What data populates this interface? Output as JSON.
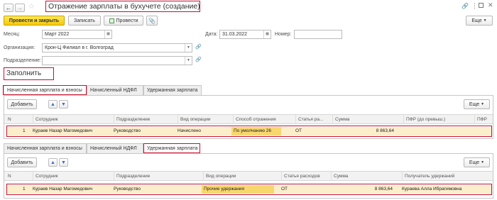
{
  "window": {
    "back_icon": "arrow-left-icon",
    "forward_icon": "arrow-right-icon",
    "favorite_icon": "star-icon",
    "title": "Отражение зарплаты в бухучете (создание)",
    "link_icon": "link-icon",
    "menu_icon": "more-dots-icon",
    "maximize_icon": "maximize-icon",
    "close_icon": "close-icon"
  },
  "toolbar": {
    "post_and_close": "Провести и закрыть",
    "save": "Записать",
    "post": "Провести",
    "attach_icon": "paperclip-icon",
    "more": "Еще"
  },
  "form": {
    "month_label": "Месяц:",
    "month_value": "Март 2022",
    "date_label": "Дата:",
    "date_value": "31.03.2022",
    "number_label": "Номер:",
    "number_value": "",
    "org_label": "Организация:",
    "org_value": "Крон-Ц Филиал в г. Волгоград",
    "dept_label": "Подразделение:",
    "dept_value": ""
  },
  "fill_button": "Заполнить",
  "tabs": [
    "Начисленная зарплата и взносы",
    "Начисленный НДФЛ",
    "Удержанная зарплата"
  ],
  "table1": {
    "add_button": "Добавить",
    "more": "Еще",
    "headers": [
      "N",
      "Сотрудник",
      "Подразделение",
      "Вид операции",
      "Способ отражения",
      "Статья ра...",
      "Сумма",
      "ПФР (до превыш.)",
      "ПФР"
    ],
    "rows": [
      {
        "n": "1",
        "employee": "Кураев Назар Магомедович",
        "department": "Руководство",
        "operation": "Начислено",
        "method": "По умолчанию 26",
        "article": "ОТ",
        "amount": "8 863,64",
        "pfr": "",
        "pfr2": ""
      }
    ]
  },
  "table2": {
    "add_button": "Добавить",
    "more": "Еще",
    "headers": [
      "N",
      "Сотрудник",
      "Подразделение",
      "Вид операции",
      "Статья расходов",
      "Сумма",
      "Получатель удержаний"
    ],
    "rows": [
      {
        "n": "1",
        "employee": "Кураев Назар Магомедович",
        "department": "Руководство",
        "operation": "Прочие удержания",
        "article": "ОТ",
        "amount": "8 863,64",
        "recipient": "Кураева Алла Ибрагимовна"
      }
    ]
  }
}
